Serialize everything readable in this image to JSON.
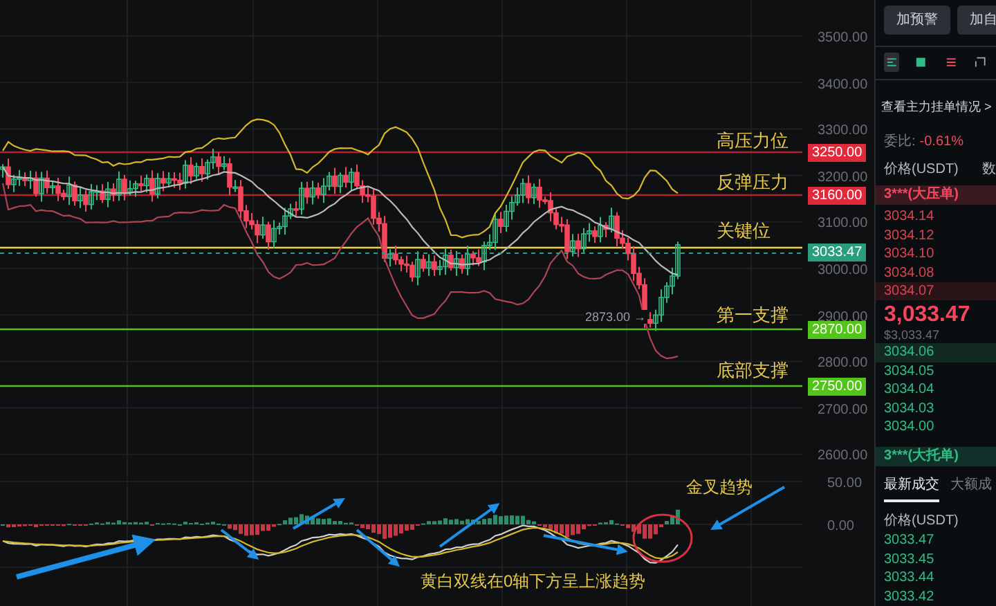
{
  "chart": {
    "price_axis": [
      "3500.00",
      "3400.00",
      "3300.00",
      "3200.00",
      "3100.00",
      "3000.00",
      "2900.00",
      "2800.00",
      "2700.00",
      "2600.00"
    ],
    "levels": [
      {
        "kind": "resistance",
        "label": "高压力位",
        "tag": "3250.00"
      },
      {
        "kind": "resistance",
        "label": "反弹压力",
        "tag": "3160.00"
      },
      {
        "kind": "key",
        "label": "关键位"
      },
      {
        "kind": "support",
        "label": "第一支撑",
        "tag": "2870.00"
      },
      {
        "kind": "support",
        "label": "底部支撑",
        "tag": "2750.00"
      }
    ],
    "current_price_tag": "3033.47",
    "low_marker": "2873.00 →"
  },
  "macd": {
    "axis": [
      "50.00",
      "0.00"
    ],
    "annotations": [
      {
        "kind": "cross",
        "text": "金叉趋势"
      },
      {
        "kind": "trend",
        "text": "黄白双线在0轴下方呈上涨趋势"
      }
    ]
  },
  "side_panel": {
    "buttons": [
      "加预警",
      "加自"
    ],
    "view_icons": [
      {
        "kind": "both",
        "selected": true
      },
      {
        "kind": "bids",
        "selected": false
      },
      {
        "kind": "asks",
        "selected": false
      },
      {
        "kind": "expand",
        "selected": false
      }
    ],
    "depth_link": "查看主力挂单情况 >",
    "ratio_label": "委比:",
    "ratio_value": "-0.61%",
    "book_header": [
      "价格(USDT)",
      "数"
    ],
    "ask_wall": "3***(大压单)",
    "asks": [
      {
        "price": "3034.14",
        "highlighted": false
      },
      {
        "price": "3034.12",
        "highlighted": false
      },
      {
        "price": "3034.10",
        "highlighted": false
      },
      {
        "price": "3034.08",
        "highlighted": false
      },
      {
        "price": "3034.07",
        "highlighted": true
      }
    ],
    "last_price": "3,033.47",
    "last_price_usd": "$3,033.47",
    "bids": [
      {
        "price": "3034.06",
        "highlighted": true
      },
      {
        "price": "3034.05",
        "highlighted": false
      },
      {
        "price": "3034.04",
        "highlighted": false
      },
      {
        "price": "3034.03",
        "highlighted": false
      },
      {
        "price": "3034.00",
        "highlighted": false
      }
    ],
    "bid_wall": "3***(大托单)",
    "tabs": [
      {
        "label": "最新成交",
        "selected": true
      },
      {
        "label": "大额成",
        "selected": false
      }
    ],
    "trades_header": "价格(USDT)",
    "trades": [
      "3033.47",
      "3033.45",
      "3033.44",
      "3033.42"
    ]
  }
}
